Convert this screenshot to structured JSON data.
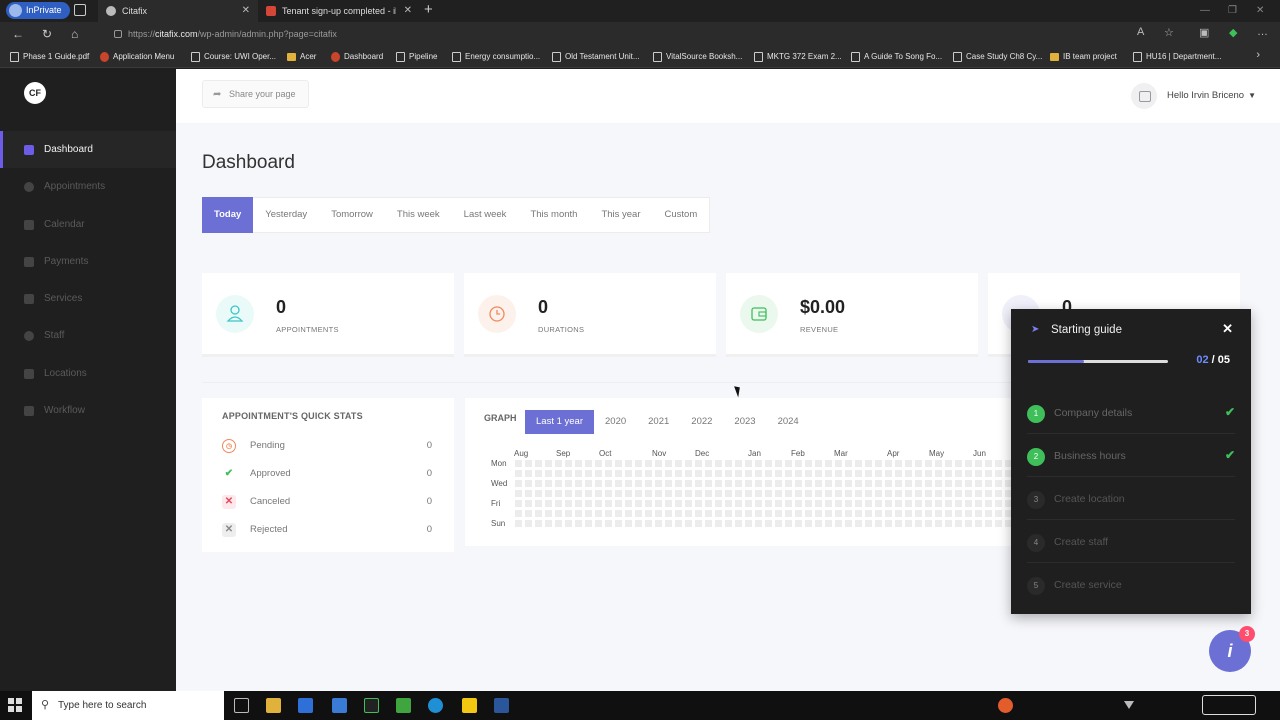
{
  "browser": {
    "inprivate": "InPrivate",
    "tabs": [
      {
        "title": "Citafix",
        "active": true
      },
      {
        "title": "Tenant sign-up completed - ibric",
        "active": false
      }
    ],
    "url_prefix": "https://",
    "url_domain": "citafix.com",
    "url_path": "/wp-admin/admin.php?page=citafix",
    "bookmarks": [
      "Phase 1 Guide.pdf",
      "Application Menu",
      "Course: UWI Oper...",
      "Acer",
      "Dashboard",
      "Pipeline",
      "Energy consumptio...",
      "Old Testament Unit...",
      "VitalSource Booksh...",
      "MKTG 372 Exam 2...",
      "A Guide To Song Fo...",
      "Case Study Ch8 Cy...",
      "IB team project",
      "HU16 | Department..."
    ]
  },
  "sidebar": {
    "logo": "CF",
    "items": [
      {
        "label": "Dashboard",
        "active": true
      },
      {
        "label": "Appointments",
        "active": false
      },
      {
        "label": "Calendar",
        "active": false
      },
      {
        "label": "Payments",
        "active": false
      },
      {
        "label": "Services",
        "active": false
      },
      {
        "label": "Staff",
        "active": false
      },
      {
        "label": "Locations",
        "active": false
      },
      {
        "label": "Workflow",
        "active": false
      }
    ]
  },
  "header": {
    "share_label": "Share your page",
    "user_greeting": "Hello Irvin Briceno"
  },
  "page": {
    "title": "Dashboard",
    "filters": [
      "Today",
      "Yesterday",
      "Tomorrow",
      "This week",
      "Last week",
      "This month",
      "This year",
      "Custom"
    ],
    "active_filter": "Today"
  },
  "stats": [
    {
      "value": "0",
      "label": "APPOINTMENTS",
      "color": "#3cc6c6"
    },
    {
      "value": "0",
      "label": "DURATIONS",
      "color": "#f08a5d"
    },
    {
      "value": "$0.00",
      "label": "REVENUE",
      "color": "#3fbf5a"
    },
    {
      "value": "0",
      "label": "",
      "color": "#6c6fd4"
    }
  ],
  "quick_stats": {
    "title": "APPOINTMENT'S QUICK STATS",
    "rows": [
      {
        "label": "Pending",
        "count": "0",
        "icon": "clock-icon",
        "color": "#f08a5d"
      },
      {
        "label": "Approved",
        "count": "0",
        "icon": "check-icon",
        "color": "#3fbf5a"
      },
      {
        "label": "Canceled",
        "count": "0",
        "icon": "x-icon",
        "color": "#e8455a"
      },
      {
        "label": "Rejected",
        "count": "0",
        "icon": "x-icon",
        "color": "#888888"
      }
    ]
  },
  "graph": {
    "title": "GRAPH",
    "tabs": [
      "Last 1 year",
      "2020",
      "2021",
      "2022",
      "2023",
      "2024"
    ],
    "active_tab": "Last 1 year",
    "months": [
      "Aug",
      "Sep",
      "Oct",
      "Nov",
      "Dec",
      "Jan",
      "Feb",
      "Mar",
      "Apr",
      "May",
      "Jun"
    ],
    "days": [
      "Mon",
      "Wed",
      "Fri",
      "Sun"
    ]
  },
  "guide": {
    "title": "Starting guide",
    "current": "02",
    "total": "05",
    "progress": 0.4,
    "steps": [
      {
        "num": "1",
        "label": "Company details",
        "done": true
      },
      {
        "num": "2",
        "label": "Business hours",
        "done": true
      },
      {
        "num": "3",
        "label": "Create location",
        "done": false
      },
      {
        "num": "4",
        "label": "Create staff",
        "done": false
      },
      {
        "num": "5",
        "label": "Create service",
        "done": false
      }
    ]
  },
  "help": {
    "label": "i",
    "badge": "3"
  },
  "taskbar": {
    "search_placeholder": "Type here to search"
  },
  "colors": {
    "accent": "#6c6fd4",
    "sidebar_bg": "#1f1f1f",
    "success": "#3fbf5a"
  }
}
